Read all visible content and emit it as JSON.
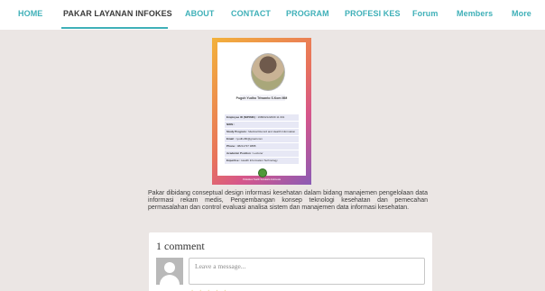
{
  "nav": {
    "items": [
      {
        "label": "HOME"
      },
      {
        "label": "PAKAR LAYANAN INFOKES"
      },
      {
        "label": "ABOUT"
      },
      {
        "label": "CONTACT"
      },
      {
        "label": "PROGRAM"
      },
      {
        "label": "PROFESI KES"
      },
      {
        "label": "Forum"
      },
      {
        "label": "Members"
      },
      {
        "label": "More"
      }
    ],
    "active_index": 1
  },
  "profile_card": {
    "name": "Pugoh Yudho Triwanto S.Kom MM",
    "rows": [
      {
        "label": "Employee ID (NIP/NIK) :",
        "value": "198002122009 11 001"
      },
      {
        "label": "NIDN :",
        "value": ""
      },
      {
        "label": "Study Program :",
        "value": "Medical Record and Health Information"
      },
      {
        "label": "Email :",
        "value": "ryudho80@gmail.com"
      },
      {
        "label": "Phone :",
        "value": "08211737 9888"
      },
      {
        "label": "Academic Position :",
        "value": "Lecturer"
      },
      {
        "label": "Expertise :",
        "value": "Health Information Technology"
      }
    ],
    "footer": "Poltekkes Health Surakarta Indonesia"
  },
  "description": "Pakar dibidang conseptual design informasi kesehatan dalam bidang manajemen pengelolaan data informasi rekam medis, Pengembangan konsep teknologi kesehatan dan pemecahan permasalahan dan control evaluasi analisa sistem dan manajemen data informasi kesehatan.",
  "comments": {
    "title": "1 comment",
    "placeholder": "Leave a message...",
    "rating": "★★★★★"
  },
  "colors": {
    "accent": "#3fb0b8",
    "background": "#ebe6e4"
  }
}
